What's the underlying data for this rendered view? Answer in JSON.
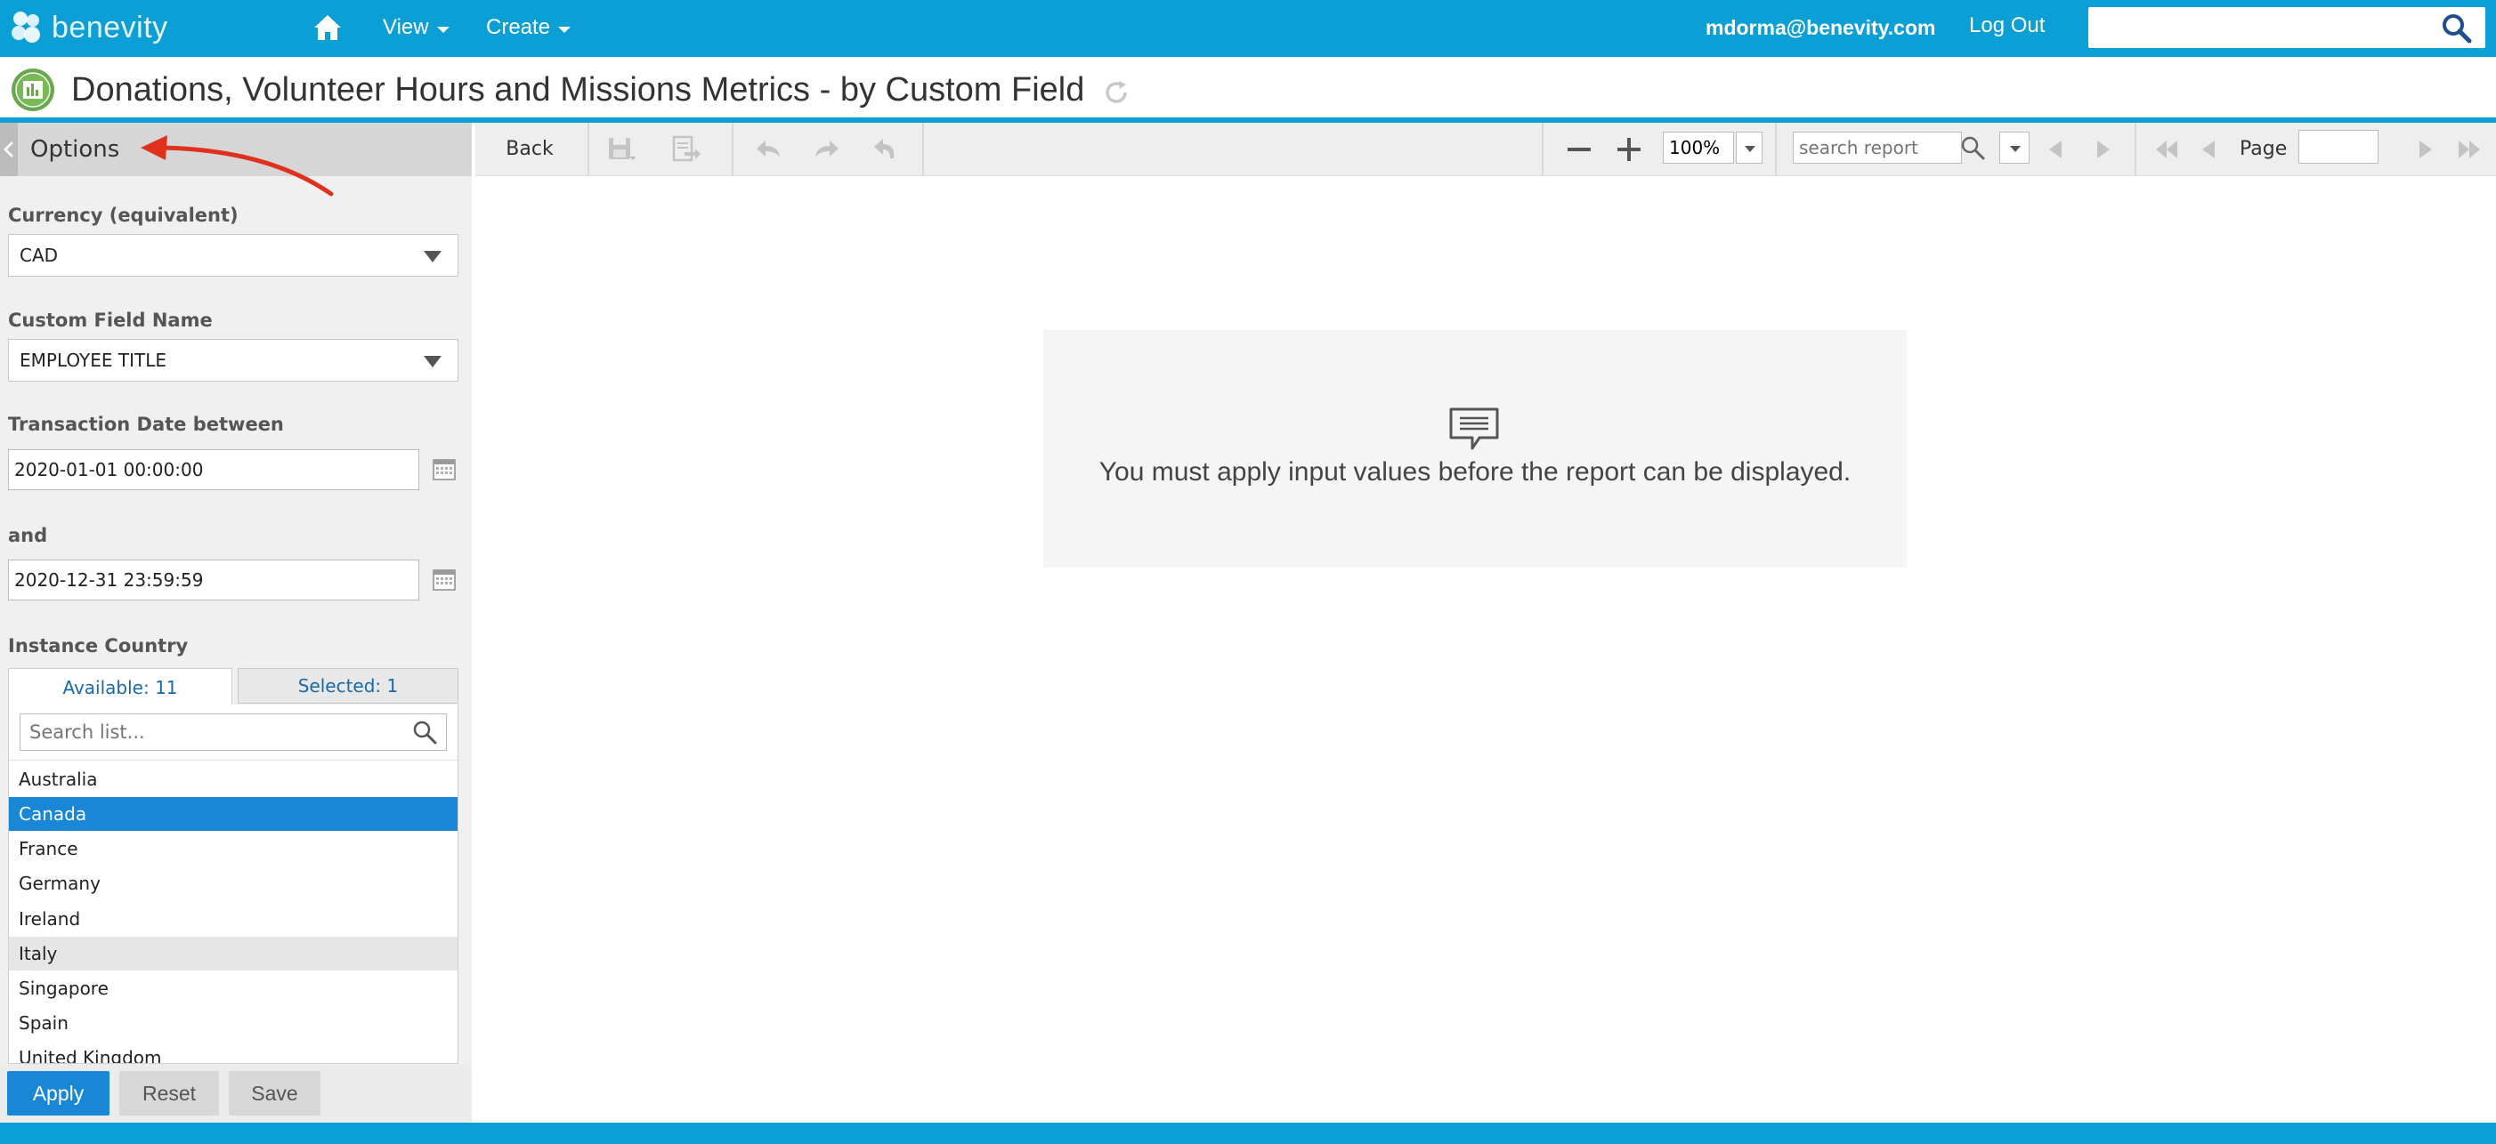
{
  "topnav": {
    "logo_text": "benevity",
    "view_label": "View",
    "create_label": "Create",
    "user_email": "mdorma@benevity.com",
    "logout_label": "Log Out",
    "search_value": ""
  },
  "report": {
    "title": "Donations, Volunteer Hours and Missions Metrics - by Custom Field"
  },
  "options": {
    "title": "Options",
    "currency": {
      "label": "Currency (equivalent)",
      "value": "CAD"
    },
    "custom_field": {
      "label": "Custom Field Name",
      "value": "EMPLOYEE TITLE"
    },
    "date_from": {
      "label": "Transaction Date between",
      "value": "2020-01-01 00:00:00"
    },
    "date_to": {
      "label": "and",
      "value": "2020-12-31 23:59:59"
    },
    "country": {
      "label": "Instance Country",
      "tab_available": "Available: 11",
      "tab_selected": "Selected: 1",
      "search_placeholder": "Search list...",
      "items": [
        "Australia",
        "Canada",
        "France",
        "Germany",
        "Ireland",
        "Italy",
        "Singapore",
        "Spain",
        "United Kingdom"
      ],
      "selected_item": "Canada",
      "hovered_item": "Italy"
    },
    "buttons": {
      "apply": "Apply",
      "reset": "Reset",
      "save": "Save"
    }
  },
  "toolbar": {
    "back_label": "Back",
    "zoom_value": "100%",
    "search_placeholder": "search report",
    "page_label": "Page",
    "page_value": ""
  },
  "message": {
    "text": "You must apply input values before the report can be displayed."
  },
  "colors": {
    "brand": "#0b9fd6",
    "primary_button": "#1a86d6",
    "annotation_arrow": "#e0311f"
  },
  "icons": [
    "home-icon",
    "search-icon",
    "report-chart-icon",
    "refresh-icon",
    "chevron-left-icon",
    "dropdown-arrow-icon",
    "calendar-icon",
    "save-icon",
    "export-icon",
    "undo-icon",
    "redo-icon",
    "reset-undo-icon",
    "zoom-out-icon",
    "zoom-in-icon",
    "first-page-icon",
    "previous-page-icon",
    "next-page-icon",
    "last-page-icon",
    "comment-icon"
  ]
}
